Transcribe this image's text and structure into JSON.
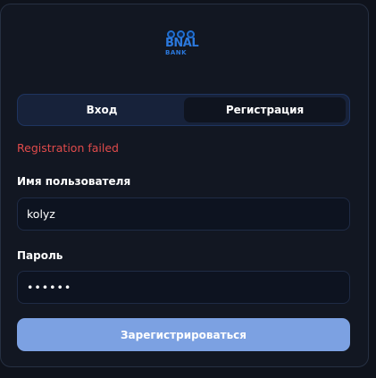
{
  "logo": {
    "word": "BNAL",
    "sub": "BANK",
    "color": "#2b78dc"
  },
  "tabs": [
    {
      "label": "Вход",
      "active": false
    },
    {
      "label": "Регистрация",
      "active": true
    }
  ],
  "form": {
    "error": "Registration failed",
    "username_label": "Имя пользователя",
    "username_value": "kolyz",
    "password_label": "Пароль",
    "password_value": "••••••",
    "submit_label": "Зарегистрироваться"
  },
  "colors": {
    "error": "#e04b4b",
    "button": "#7ca1e2"
  }
}
